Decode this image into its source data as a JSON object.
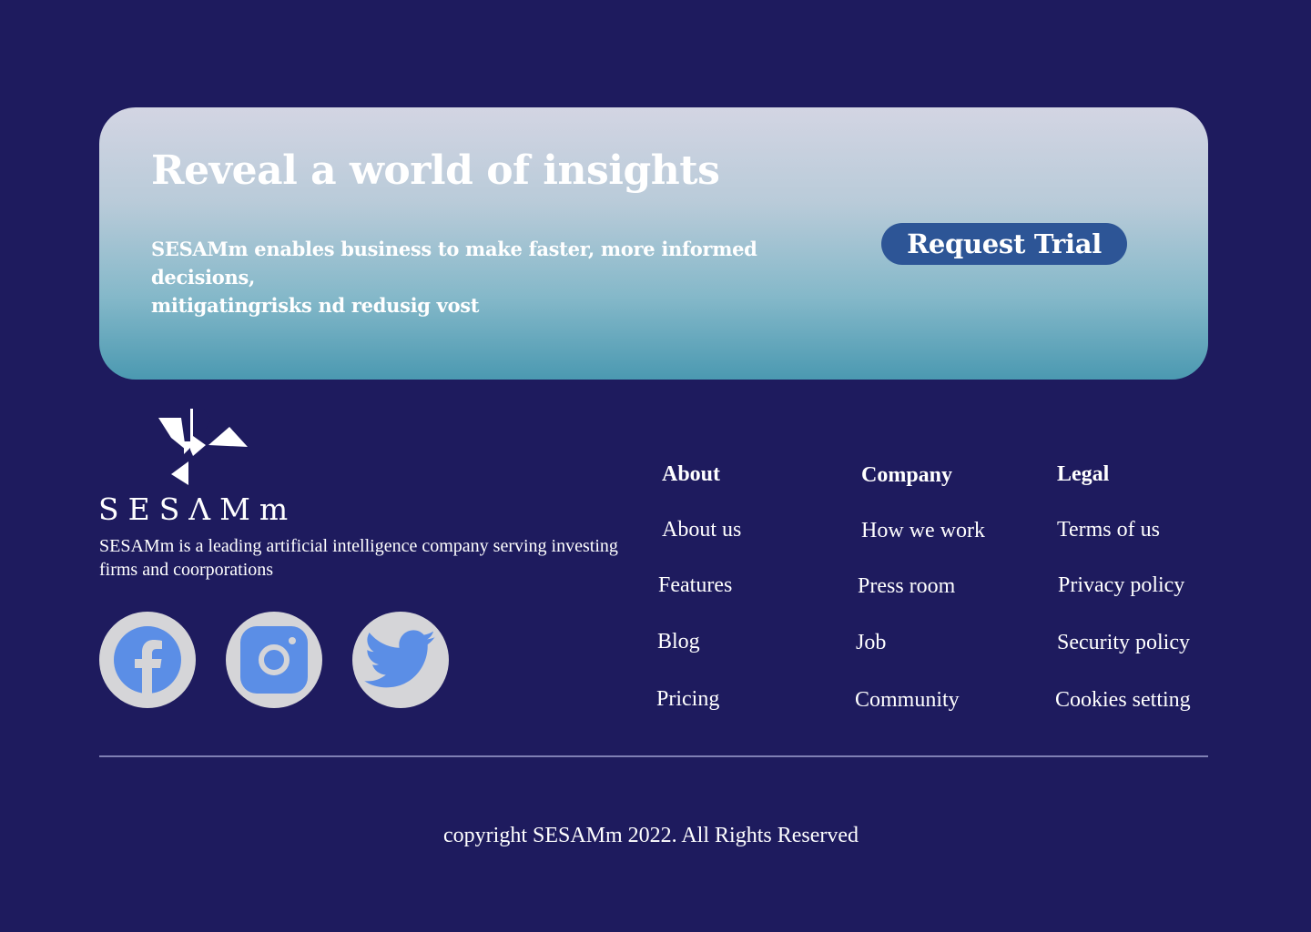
{
  "cta": {
    "title": "Reveal a world of insights",
    "description_line1": "SESAMm enables business to make faster, more informed decisions,",
    "description_line2": "mitigatingrisks nd redusig vost",
    "button_label": "Request Trial"
  },
  "brand": {
    "logo_text": "SESΛMm",
    "description": "SESAMm is a leading artificial intelligence company serving investing firms and coorporations"
  },
  "social": [
    {
      "name": "facebook-icon",
      "color": "#5b8ee6"
    },
    {
      "name": "instagram-icon",
      "color": "#5b8ee6"
    },
    {
      "name": "twitter-icon",
      "color": "#5b8ee6"
    }
  ],
  "footer": {
    "about": {
      "heading": "About",
      "links": [
        "About us",
        "Features",
        "Blog",
        "Pricing"
      ]
    },
    "company": {
      "heading": "Company",
      "links": [
        "How we work",
        "Press room",
        "Job",
        "Community"
      ]
    },
    "legal": {
      "heading": "Legal",
      "links": [
        "Terms of us",
        "Privacy policy",
        "Security policy",
        "Cookies setting"
      ]
    }
  },
  "copyright": "copyright SESAMm 2022. All Rights Reserved",
  "colors": {
    "background": "#1e1b5e",
    "button": "#2d5596",
    "social_bg": "#d5d5d8",
    "social_icon": "#5b8ee6"
  }
}
